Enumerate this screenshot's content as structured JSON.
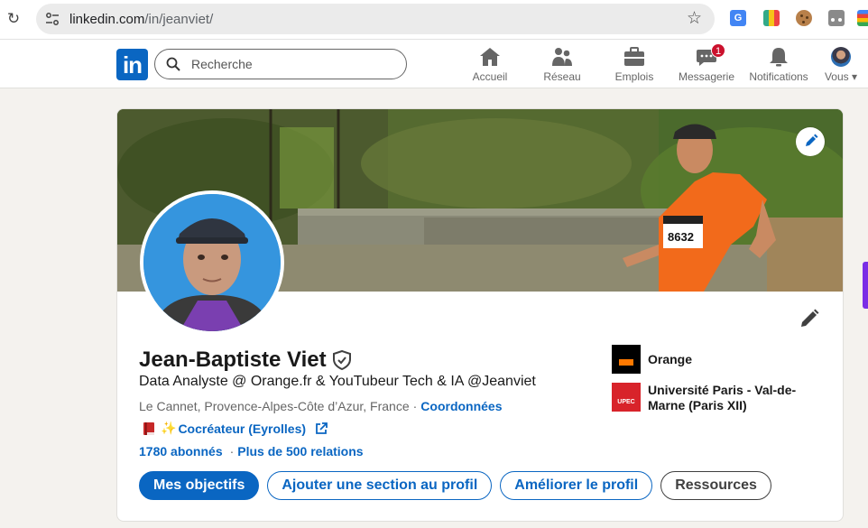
{
  "browser": {
    "url_host": "linkedin.com",
    "url_path": "/in/jeanviet/",
    "extension_translate_label": "G"
  },
  "nav": {
    "logo_text": "in",
    "search_placeholder": "Recherche",
    "items": [
      {
        "label": "Accueil",
        "icon": "home-icon"
      },
      {
        "label": "Réseau",
        "icon": "network-icon"
      },
      {
        "label": "Emplois",
        "icon": "briefcase-icon"
      },
      {
        "label": "Messagerie",
        "icon": "messaging-icon",
        "badge": "1"
      },
      {
        "label": "Notifications",
        "icon": "bell-icon"
      },
      {
        "label": "Vous ▾",
        "icon": "avatar"
      }
    ]
  },
  "profile": {
    "name": "Jean-Baptiste Viet",
    "headline": "Data Analyste @ Orange.fr & YouTubeur Tech & IA @Jeanviet",
    "location": "Le Cannet, Provence-Alpes-Côte d’Azur, France",
    "location_sep": "·",
    "contact_link": "Coordonnées",
    "creator_sparkle": "✨",
    "creator_link": "Cocréateur (Eyrolles)",
    "followers": "1780 abonnés",
    "stats_sep": "·",
    "connections": "Plus de 500 relations",
    "bib_number": "8632",
    "orgs": [
      {
        "name": "Orange",
        "logo": "orange-logo"
      },
      {
        "name": "Université Paris - Val-de-Marne (Paris XII)",
        "logo": "upec-logo",
        "logo_text": "UPEC"
      }
    ],
    "buttons": {
      "primary": "Mes objectifs",
      "add_section": "Ajouter une section au profil",
      "improve": "Améliorer le profil",
      "resources": "Ressources"
    }
  },
  "colors": {
    "linkedin_blue": "#0a66c2",
    "badge_red": "#cb112d",
    "background": "#f4f2ee"
  }
}
